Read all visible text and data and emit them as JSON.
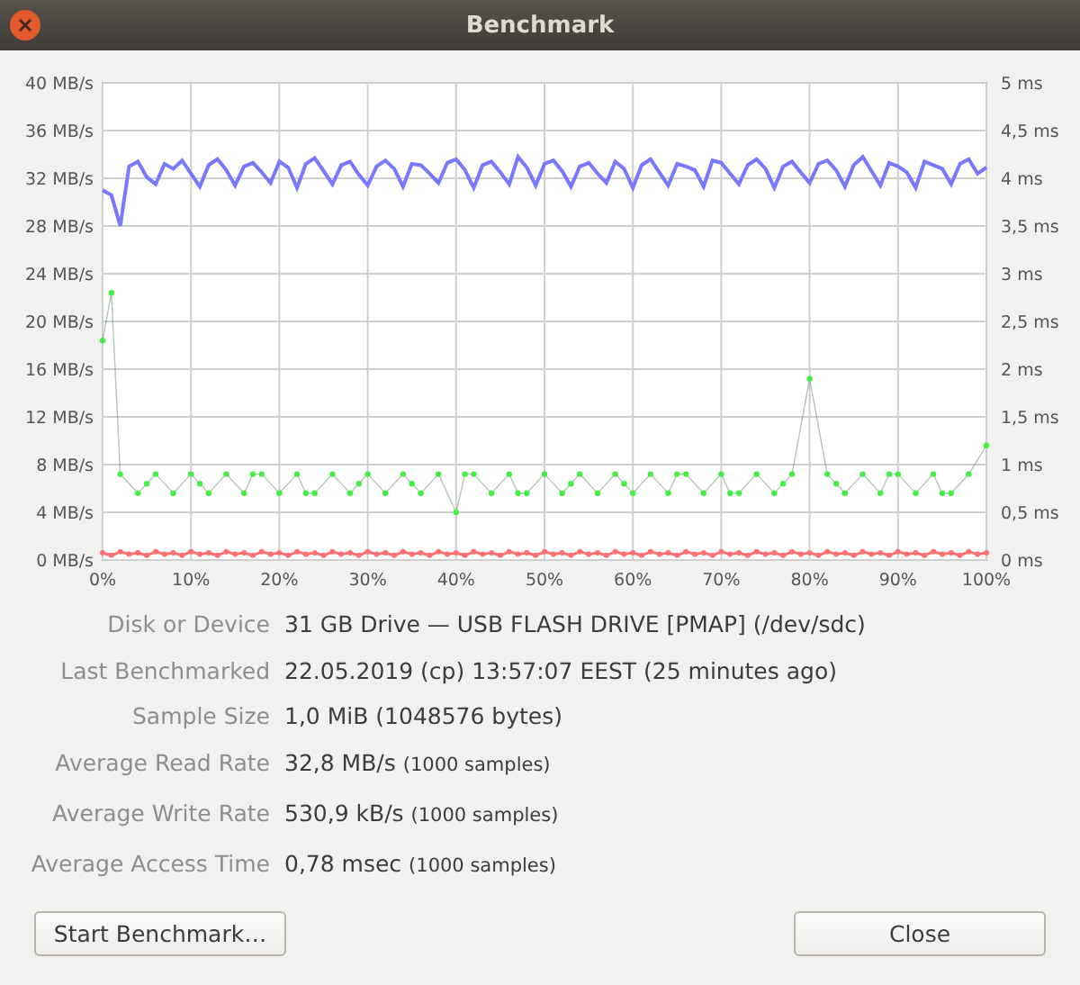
{
  "window": {
    "title": "Benchmark"
  },
  "chart": {
    "chart_data": {
      "type": "line",
      "x": [
        0,
        1,
        2,
        3,
        4,
        5,
        6,
        7,
        8,
        9,
        10,
        11,
        12,
        13,
        14,
        15,
        16,
        17,
        18,
        19,
        20,
        21,
        22,
        23,
        24,
        25,
        26,
        27,
        28,
        29,
        30,
        31,
        32,
        33,
        34,
        35,
        36,
        37,
        38,
        39,
        40,
        41,
        42,
        43,
        44,
        45,
        46,
        47,
        48,
        49,
        50,
        51,
        52,
        53,
        54,
        55,
        56,
        57,
        58,
        59,
        60,
        61,
        62,
        63,
        64,
        65,
        66,
        67,
        68,
        69,
        70,
        71,
        72,
        73,
        74,
        75,
        76,
        77,
        78,
        79,
        80,
        81,
        82,
        83,
        84,
        85,
        86,
        87,
        88,
        89,
        90,
        91,
        92,
        93,
        94,
        95,
        96,
        97,
        98,
        99,
        100
      ],
      "grid": true,
      "xlim": [
        0,
        100
      ],
      "ylim": [
        0,
        40
      ],
      "y2lim": [
        0,
        5
      ],
      "xticks": [
        {
          "value": 0,
          "label": "0%"
        },
        {
          "value": 10,
          "label": "10%"
        },
        {
          "value": 20,
          "label": "20%"
        },
        {
          "value": 30,
          "label": "30%"
        },
        {
          "value": 40,
          "label": "40%"
        },
        {
          "value": 50,
          "label": "50%"
        },
        {
          "value": 60,
          "label": "60%"
        },
        {
          "value": 70,
          "label": "70%"
        },
        {
          "value": 80,
          "label": "80%"
        },
        {
          "value": 90,
          "label": "90%"
        },
        {
          "value": 100,
          "label": "100%"
        }
      ],
      "yticks": [
        {
          "value": 0,
          "label": "0 MB/s"
        },
        {
          "value": 4,
          "label": "4 MB/s"
        },
        {
          "value": 8,
          "label": "8 MB/s"
        },
        {
          "value": 12,
          "label": "12 MB/s"
        },
        {
          "value": 16,
          "label": "16 MB/s"
        },
        {
          "value": 20,
          "label": "20 MB/s"
        },
        {
          "value": 24,
          "label": "24 MB/s"
        },
        {
          "value": 28,
          "label": "28 MB/s"
        },
        {
          "value": 32,
          "label": "32 MB/s"
        },
        {
          "value": 36,
          "label": "36 MB/s"
        },
        {
          "value": 40,
          "label": "40 MB/s"
        }
      ],
      "y2ticks": [
        {
          "value": 0,
          "label": "0 ms"
        },
        {
          "value": 0.5,
          "label": "0,5 ms"
        },
        {
          "value": 1,
          "label": "1 ms"
        },
        {
          "value": 1.5,
          "label": "1,5 ms"
        },
        {
          "value": 2,
          "label": "2 ms"
        },
        {
          "value": 2.5,
          "label": "2,5 ms"
        },
        {
          "value": 3,
          "label": "3 ms"
        },
        {
          "value": 3.5,
          "label": "3,5 ms"
        },
        {
          "value": 4,
          "label": "4 ms"
        },
        {
          "value": 4.5,
          "label": "4,5 ms"
        },
        {
          "value": 5,
          "label": "5 ms"
        }
      ],
      "series": [
        {
          "color": "#7777ff",
          "values": [
            31.0,
            30.6,
            28.0,
            33.0,
            33.4,
            32.1,
            31.5,
            33.2,
            32.8,
            33.5,
            32.4,
            31.3,
            33.1,
            33.6,
            32.7,
            31.4,
            33.0,
            33.3,
            32.5,
            31.6,
            33.4,
            32.9,
            31.2,
            33.2,
            33.7,
            32.6,
            31.5,
            33.1,
            33.4,
            32.3,
            31.4,
            33.0,
            33.5,
            32.8,
            31.3,
            33.2,
            33.1,
            32.4,
            31.6,
            33.3,
            33.6,
            32.7,
            31.2,
            33.1,
            33.4,
            32.5,
            31.5,
            33.8,
            32.9,
            31.4,
            33.2,
            33.5,
            32.6,
            31.3,
            33.0,
            33.3,
            32.4,
            31.6,
            33.4,
            32.8,
            31.2,
            33.1,
            33.6,
            32.5,
            31.4,
            33.2,
            33.0,
            32.7,
            31.3,
            33.5,
            33.3,
            32.4,
            31.5,
            33.1,
            33.6,
            32.8,
            31.2,
            33.0,
            33.4,
            32.5,
            31.6,
            33.2,
            33.5,
            32.7,
            31.3,
            33.1,
            33.8,
            32.6,
            31.4,
            33.3,
            33.0,
            32.5,
            31.2,
            33.4,
            33.1,
            32.8,
            31.5,
            33.2,
            33.6,
            32.4,
            32.9
          ]
        },
        {
          "color": "#ff7070",
          "marker": "circle",
          "values": [
            0.6,
            0.4,
            0.7,
            0.5,
            0.6,
            0.4,
            0.7,
            0.5,
            0.6,
            0.4,
            0.7,
            0.5,
            0.6,
            0.4,
            0.7,
            0.5,
            0.6,
            0.4,
            0.7,
            0.5,
            0.6,
            0.4,
            0.7,
            0.5,
            0.6,
            0.4,
            0.7,
            0.5,
            0.6,
            0.4,
            0.7,
            0.5,
            0.6,
            0.4,
            0.7,
            0.5,
            0.6,
            0.4,
            0.7,
            0.5,
            0.6,
            0.4,
            0.7,
            0.5,
            0.6,
            0.4,
            0.7,
            0.5,
            0.6,
            0.4,
            0.7,
            0.5,
            0.6,
            0.4,
            0.7,
            0.5,
            0.6,
            0.4,
            0.7,
            0.5,
            0.6,
            0.4,
            0.7,
            0.5,
            0.6,
            0.4,
            0.7,
            0.5,
            0.6,
            0.4,
            0.7,
            0.5,
            0.6,
            0.4,
            0.7,
            0.5,
            0.6,
            0.4,
            0.7,
            0.5,
            0.6,
            0.4,
            0.7,
            0.5,
            0.6,
            0.4,
            0.7,
            0.5,
            0.6,
            0.4,
            0.7,
            0.5,
            0.6,
            0.4,
            0.7,
            0.5,
            0.6,
            0.4,
            0.7,
            0.5,
            0.6
          ]
        },
        {
          "axis": "y2",
          "color": "#44ee44",
          "marker": "circle",
          "values": [
            2.3,
            2.8,
            0.9,
            null,
            0.7,
            0.8,
            0.9,
            null,
            0.7,
            null,
            0.9,
            0.8,
            0.7,
            null,
            0.9,
            null,
            0.7,
            0.9,
            0.9,
            null,
            0.7,
            null,
            0.9,
            0.7,
            0.7,
            null,
            0.9,
            null,
            0.7,
            0.8,
            0.9,
            null,
            0.7,
            null,
            0.9,
            0.8,
            0.7,
            null,
            0.9,
            null,
            0.5,
            0.9,
            0.9,
            null,
            0.7,
            null,
            0.9,
            0.7,
            0.7,
            null,
            0.9,
            null,
            0.7,
            0.8,
            0.9,
            null,
            0.7,
            null,
            0.9,
            0.8,
            0.7,
            null,
            0.9,
            null,
            0.7,
            0.9,
            0.9,
            null,
            0.7,
            null,
            0.9,
            0.7,
            0.7,
            null,
            0.9,
            null,
            0.7,
            0.8,
            0.9,
            null,
            1.9,
            null,
            0.9,
            0.8,
            0.7,
            null,
            0.9,
            null,
            0.7,
            0.9,
            0.9,
            null,
            0.7,
            null,
            0.9,
            0.7,
            0.7,
            null,
            0.9,
            null,
            1.2
          ]
        }
      ]
    }
  },
  "details": [
    {
      "label": "Disk or Device",
      "value": "31 GB Drive — USB FLASH DRIVE [PMAP] (/dev/sdc)"
    },
    {
      "label": "Last Benchmarked",
      "value": "22.05.2019 (cp) 13:57:07 EEST (25 minutes ago)"
    },
    {
      "label": "Sample Size",
      "value": "1,0 MiB (1048576 bytes)"
    },
    {
      "label": "Average Read Rate",
      "value": "32,8 MB/s",
      "note": "(1000 samples)"
    },
    {
      "label": "Average Write Rate",
      "value": "530,9 kB/s",
      "note": "(1000 samples)"
    },
    {
      "label": "Average Access Time",
      "value": "0,78 msec",
      "note": "(1000 samples)"
    }
  ],
  "buttons": [
    {
      "label": "Start Benchmark…"
    },
    {
      "label": "Close"
    }
  ]
}
